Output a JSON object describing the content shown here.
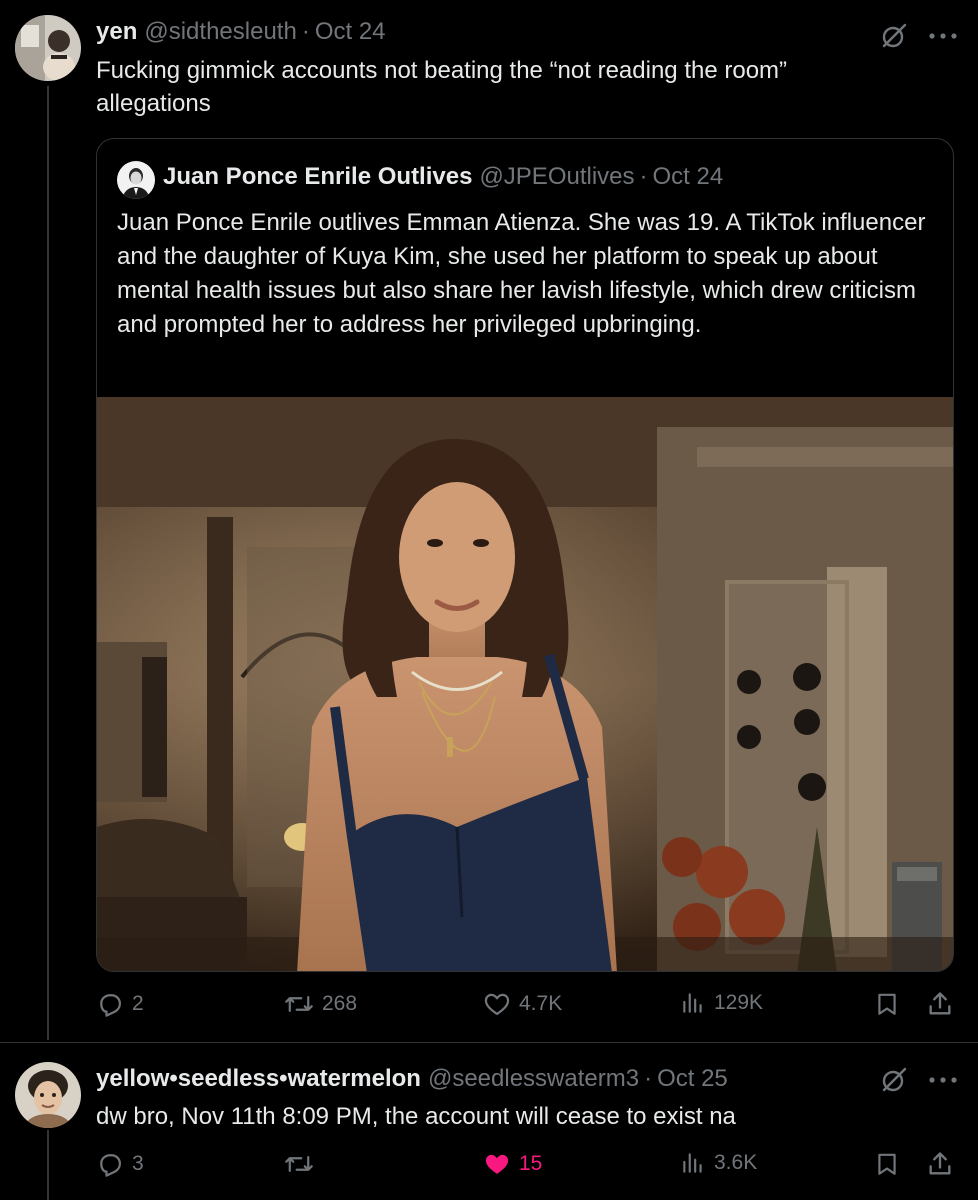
{
  "post": {
    "author_name": "yen",
    "author_handle": "@sidthesleuth",
    "separator": "·",
    "date": "Oct 24",
    "text": "Fucking gimmick accounts not beating the “not reading the room” allegations",
    "more_icon": "more-dots",
    "grok_icon": "grok-slash-circle",
    "quote": {
      "author_name": "Juan Ponce Enrile Outlives",
      "author_handle": "@JPEOutlives",
      "separator": "·",
      "date": "Oct 24",
      "text": "Juan Ponce Enrile outlives Emman Atienza. She was 19. A TikTok influencer and the daughter of Kuya Kim, she used her platform to speak up about mental health issues but also share her lavish lifestyle, which drew criticism and prompted her to address her privileged upbringing."
    },
    "stats": {
      "replies": "2",
      "reposts": "268",
      "likes": "4.7K",
      "views": "129K"
    }
  },
  "reply": {
    "author_name": "yellow•seedless•watermelon",
    "author_handle": "@seedlesswaterm3",
    "separator": "·",
    "date": "Oct 25",
    "text": "dw bro, Nov 11th 8:09 PM, the account will cease to exist na",
    "stats": {
      "replies": "3",
      "reposts": "",
      "likes": "15",
      "views": "3.6K"
    },
    "liked": true
  },
  "colors": {
    "background": "#000000",
    "text": "#e7e9ea",
    "secondary": "#71767b",
    "border": "#2f3336",
    "like_pink": "#f91880"
  }
}
